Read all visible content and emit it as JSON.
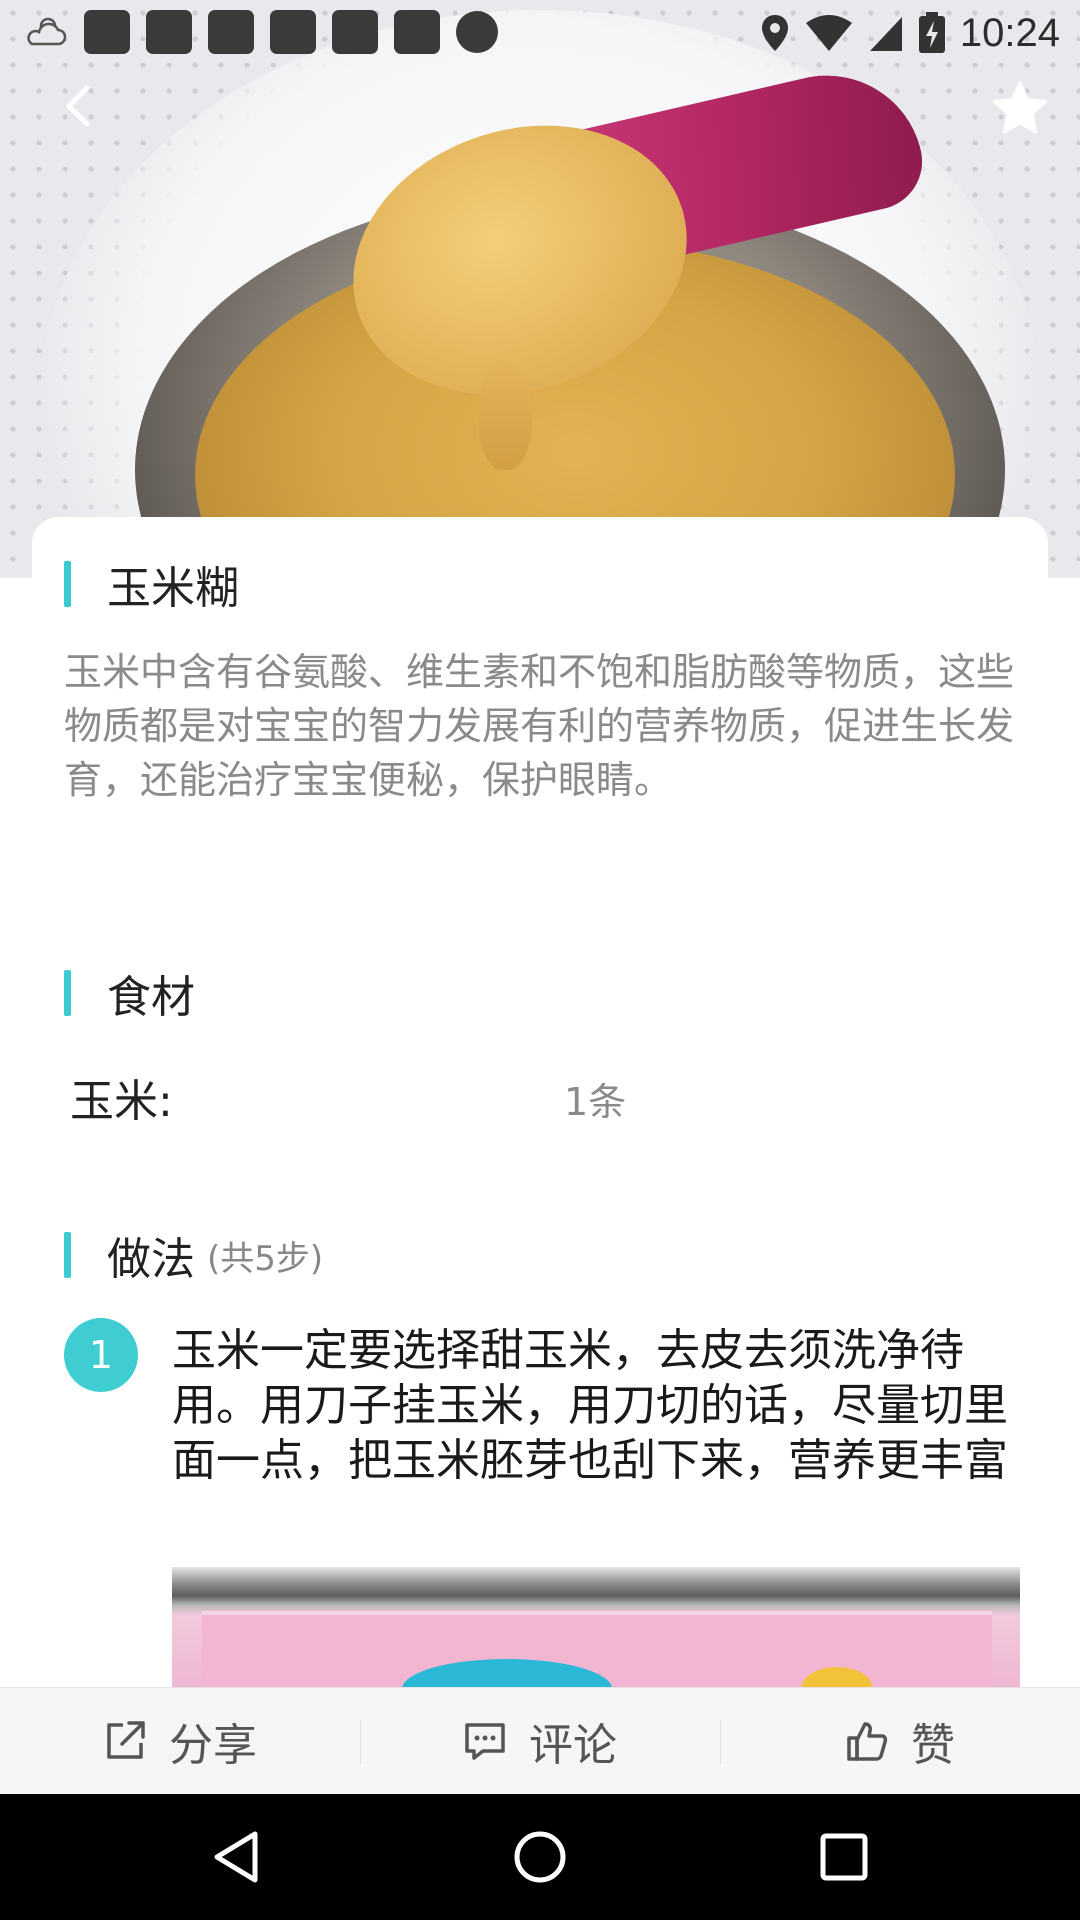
{
  "status_bar": {
    "time": "10:24",
    "icons": [
      "weather-cloudy-icon",
      "location-icon",
      "wifi-icon",
      "signal-icon",
      "battery-charging-icon"
    ]
  },
  "header": {
    "back_icon": "chevron-left-icon",
    "favorite_icon": "star-icon"
  },
  "recipe": {
    "title": "玉米糊",
    "description": "玉米中含有谷氨酸、维生素和不饱和脂肪酸等物质，这些物质都是对宝宝的智力发展有利的营养物质，促进生长发育，还能治疗宝宝便秘，保护眼睛。"
  },
  "ingredients": {
    "title": "食材",
    "items": [
      {
        "name": "玉米:",
        "amount": "1条"
      }
    ]
  },
  "method": {
    "title": "做法",
    "count_label": "(共5步)",
    "steps": [
      {
        "number": "1",
        "text": "玉米一定要选择甜玉米，去皮去须洗净待用。用刀子挂玉米，用刀切的话，尽量切里面一点，把玉米胚芽也刮下来，营养更丰富"
      }
    ]
  },
  "actions": {
    "share_label": "分享",
    "comment_label": "评论",
    "like_label": "赞"
  },
  "colors": {
    "accent": "#3cc9cf",
    "step_badge": "#3fcdd2",
    "description_text": "#8a8a8a",
    "action_bar": "#f6f6f6",
    "nav_bar": "#000000"
  }
}
